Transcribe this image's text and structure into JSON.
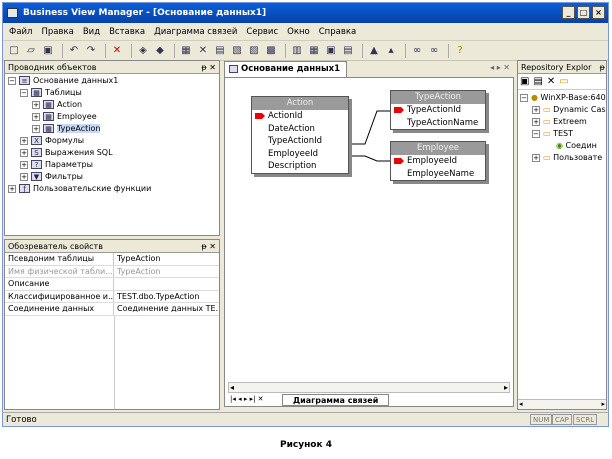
{
  "window": {
    "title": "Business View Manager - [Основание данных1]"
  },
  "menu": [
    "Файл",
    "Правка",
    "Вид",
    "Вставка",
    "Диаграмма связей",
    "Сервис",
    "Окно",
    "Справка"
  ],
  "explorer": {
    "title": "Проводник объектов",
    "root": "Основание данных1",
    "tables_label": "Таблицы",
    "tables": [
      "Action",
      "Employee",
      "TypeAction"
    ],
    "formulas": "Формулы",
    "sql": "Выражения SQL",
    "params": "Параметры",
    "filters": "Фильтры",
    "user_funcs": "Пользовательские функции"
  },
  "props": {
    "title": "Обозреватель свойств",
    "rows": [
      {
        "k": "Псевдоним таблицы",
        "v": "TypeAction"
      },
      {
        "k": "Имя физической табли...",
        "v": "TypeAction"
      },
      {
        "k": "Описание",
        "v": ""
      },
      {
        "k": "Классифицированное и...",
        "v": "TEST.dbo.TypeAction"
      },
      {
        "k": "Соединение данных",
        "v": "Соединение данных TE..."
      }
    ]
  },
  "doc": {
    "tab": "Основание данных1",
    "bottom_tab": "Диаграмма связей"
  },
  "diagram": {
    "action": {
      "name": "Action",
      "fields": [
        "ActionId",
        "DateAction",
        "TypeActionId",
        "EmployeeId",
        "Description"
      ]
    },
    "typeaction": {
      "name": "TypeAction",
      "fields": [
        "TypeActionId",
        "TypeActionName"
      ]
    },
    "employee": {
      "name": "Employee",
      "fields": [
        "EmployeeId",
        "EmployeeName"
      ]
    }
  },
  "repo": {
    "title": "Repository Explor",
    "items": [
      "WinXP-Base:640",
      "Dynamic Cas",
      "Extreem",
      "TEST",
      "Соедин",
      "Пользовате"
    ]
  },
  "status": {
    "text": "Готово",
    "num": "NUM",
    "cap": "CAP",
    "scrl": "SCRL"
  },
  "caption": "Рисунок 4"
}
